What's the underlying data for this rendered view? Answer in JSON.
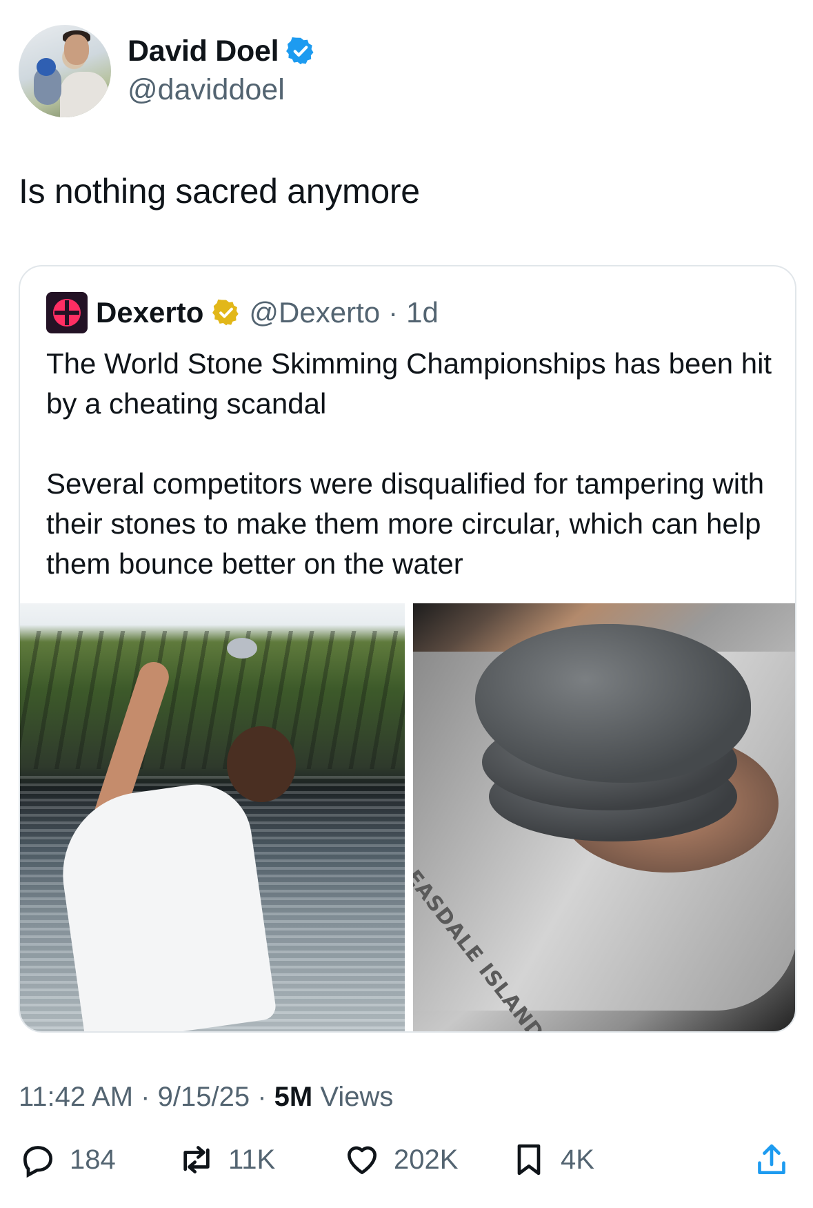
{
  "author": {
    "display_name": "David Doel",
    "handle": "@daviddoel",
    "verified": true
  },
  "tweet": {
    "text": "Is nothing sacred anymore"
  },
  "quoted": {
    "name": "Dexerto",
    "handle": "@Dexerto",
    "separator": "·",
    "age": "1d",
    "paragraphs": [
      "The World Stone Skimming Championships has been hit by a cheating scandal",
      "Several competitors were disqualified for tampering with their stones to make them more circular, which can help them bounce better on the water"
    ],
    "image_right_engraving": "EASDALE ISLAND"
  },
  "meta": {
    "time": "11:42 AM",
    "date": "9/15/25",
    "views_count": "5M",
    "views_label": "Views",
    "sep": "·"
  },
  "actions": {
    "replies": "184",
    "reposts": "11K",
    "likes": "202K",
    "bookmarks": "4K"
  },
  "colors": {
    "verified_blue": "#1d9bf0",
    "verified_gold": "#e2b719",
    "muted": "#536471"
  }
}
